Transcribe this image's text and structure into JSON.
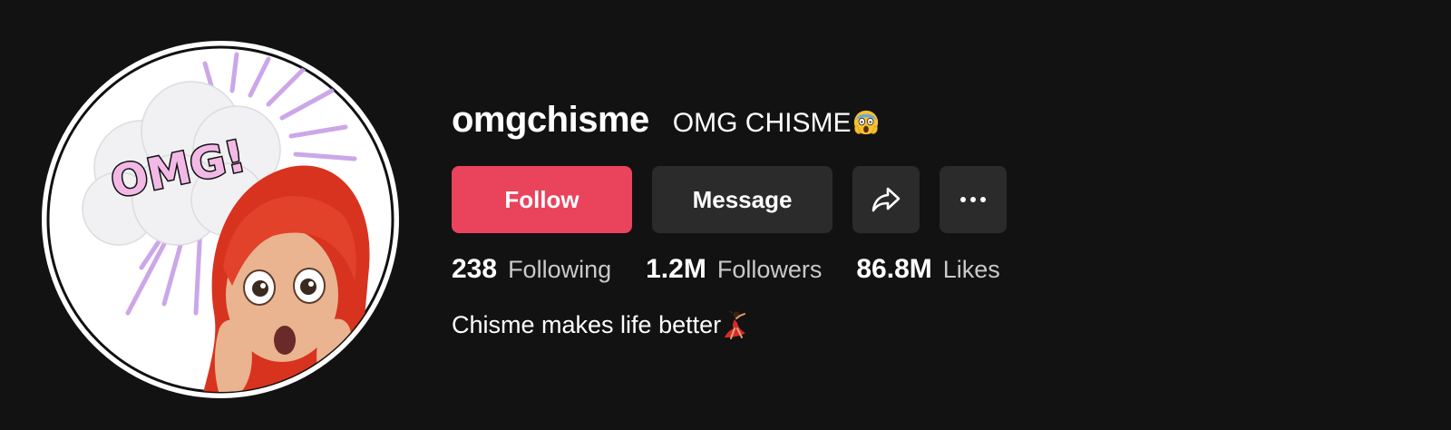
{
  "profile": {
    "username": "omgchisme",
    "nickname": "OMG CHISME",
    "nickname_emoji": "scream-emoji",
    "avatar_text": "OMG!",
    "bio": "Chisme makes life better",
    "bio_emoji": "dancer-emoji"
  },
  "actions": {
    "follow_label": "Follow",
    "message_label": "Message",
    "share_icon": "share-arrow-icon",
    "more_icon": "more-dots-icon"
  },
  "stats": [
    {
      "value": "238",
      "label": "Following"
    },
    {
      "value": "1.2M",
      "label": "Followers"
    },
    {
      "value": "86.8M",
      "label": "Likes"
    }
  ],
  "colors": {
    "background": "#121212",
    "follow_button": "#ea435c",
    "secondary_button": "#2b2b2b",
    "stat_label": "#c9c9c9"
  }
}
